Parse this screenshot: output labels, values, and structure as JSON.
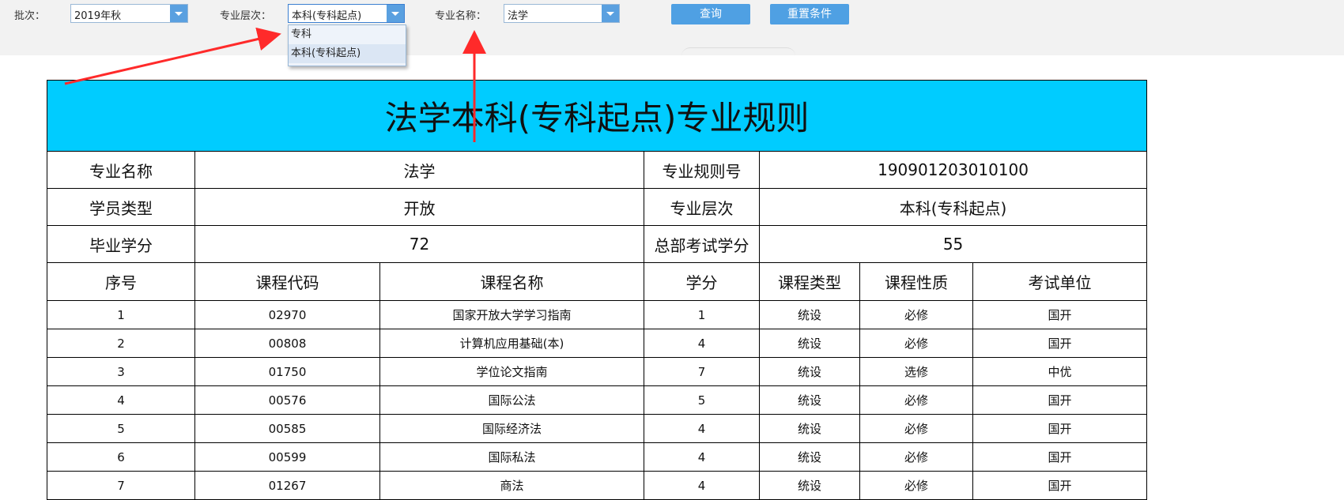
{
  "filters": {
    "batch_label": "批次：",
    "batch_value": "2019年秋",
    "level_label": "专业层次：",
    "level_value": "本科(专科起点)",
    "major_label": "专业名称：",
    "major_value": "法学",
    "query_button": "查询",
    "reset_button": "重置条件"
  },
  "dropdown": {
    "options": [
      "专科",
      "本科(专科起点)"
    ]
  },
  "rule": {
    "title": "法学本科(专科起点)专业规则",
    "info": {
      "major_name_label": "专业名称",
      "major_name": "法学",
      "rule_no_label": "专业规则号",
      "rule_no": "190901203010100",
      "student_type_label": "学员类型",
      "student_type": "开放",
      "level_label": "专业层次",
      "level": "本科(专科起点)",
      "grad_credits_label": "毕业学分",
      "grad_credits": "72",
      "hq_exam_credits_label": "总部考试学分",
      "hq_exam_credits": "55"
    },
    "columns": [
      "序号",
      "课程代码",
      "课程名称",
      "学分",
      "课程类型",
      "课程性质",
      "考试单位"
    ],
    "courses": [
      [
        "1",
        "02970",
        "国家开放大学学习指南",
        "1",
        "统设",
        "必修",
        "国开"
      ],
      [
        "2",
        "00808",
        "计算机应用基础(本)",
        "4",
        "统设",
        "必修",
        "国开"
      ],
      [
        "3",
        "01750",
        "学位论文指南",
        "7",
        "统设",
        "选修",
        "中优"
      ],
      [
        "4",
        "00576",
        "国际公法",
        "5",
        "统设",
        "必修",
        "国开"
      ],
      [
        "5",
        "00585",
        "国际经济法",
        "4",
        "统设",
        "必修",
        "国开"
      ],
      [
        "6",
        "00599",
        "国际私法",
        "4",
        "统设",
        "必修",
        "国开"
      ],
      [
        "7",
        "01267",
        "商法",
        "4",
        "统设",
        "必修",
        "国开"
      ]
    ]
  },
  "colors": {
    "title_bg": "#00ccff",
    "button_bg": "#4fa0e3",
    "annotation_arrow": "#ff2a2a"
  }
}
